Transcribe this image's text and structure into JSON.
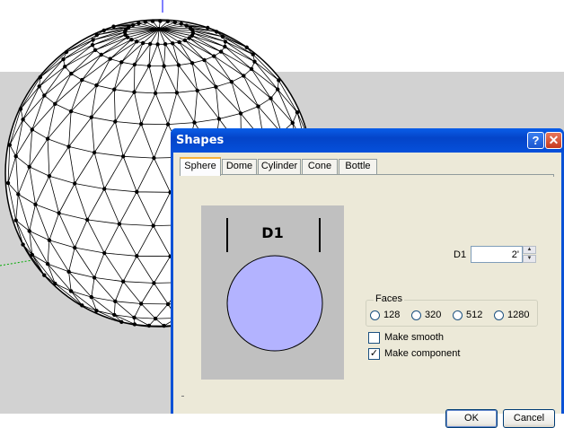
{
  "dialog": {
    "title": "Shapes",
    "help_glyph": "?",
    "close_glyph": "✕",
    "tabs": [
      {
        "label": "Sphere",
        "active": true
      },
      {
        "label": "Dome",
        "active": false
      },
      {
        "label": "Cylinder",
        "active": false
      },
      {
        "label": "Cone",
        "active": false
      },
      {
        "label": "Bottle",
        "active": false
      }
    ],
    "preview": {
      "dimension_label": "D1",
      "circle_color": "#b3b3ff"
    },
    "d1": {
      "label": "D1",
      "value": "2'"
    },
    "faces": {
      "legend": "Faces",
      "options": [
        "128",
        "320",
        "512",
        "1280"
      ]
    },
    "make_smooth": {
      "label": "Make smooth",
      "checked": false
    },
    "make_component": {
      "label": "Make component",
      "checked": true,
      "mark": "✓"
    },
    "ok_label": "OK",
    "cancel_label": "Cancel"
  },
  "icons": {
    "help": "help-icon",
    "close": "close-icon"
  },
  "colors": {
    "title_bar": "#0a52d6",
    "dialog_face": "#ece9d8",
    "viewport_sky": "#ffffff",
    "viewport_ground": "#d2d2d2",
    "axis_blue": "#0000ff",
    "axis_green": "#00aa00"
  }
}
